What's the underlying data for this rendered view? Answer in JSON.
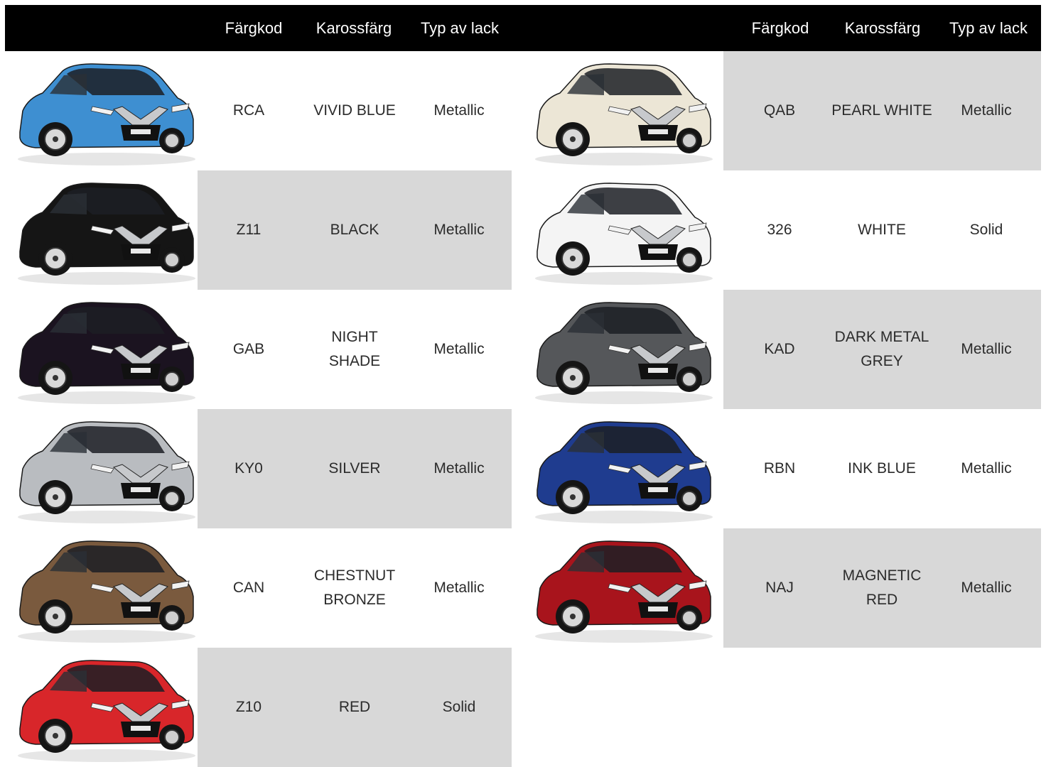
{
  "header": {
    "left": {
      "code": "Färgkod",
      "color": "Karossfärg",
      "paint": "Typ av lack"
    },
    "right": {
      "code": "Färgkod",
      "color": "Karossfärg",
      "paint": "Typ av lack"
    }
  },
  "left_rows": [
    {
      "code": "RCA",
      "color_line1": "VIVID BLUE",
      "color_line2": "",
      "paint": "Metallic",
      "car_hex": "#3e8fd1"
    },
    {
      "code": "Z11",
      "color_line1": "BLACK",
      "color_line2": "",
      "paint": "Metallic",
      "car_hex": "#151515"
    },
    {
      "code": "GAB",
      "color_line1": "NIGHT",
      "color_line2": "SHADE",
      "paint": "Metallic",
      "car_hex": "#1b1320"
    },
    {
      "code": "KY0",
      "color_line1": "SILVER",
      "color_line2": "",
      "paint": "Metallic",
      "car_hex": "#b9bcc0"
    },
    {
      "code": "CAN",
      "color_line1": "CHESTNUT",
      "color_line2": "BRONZE",
      "paint": "Metallic",
      "car_hex": "#7a5a3e"
    },
    {
      "code": "Z10",
      "color_line1": "RED",
      "color_line2": "",
      "paint": "Solid",
      "car_hex": "#d8262a"
    }
  ],
  "right_rows": [
    {
      "code": "QAB",
      "color_line1": "PEARL WHITE",
      "color_line2": "",
      "paint": "Metallic",
      "car_hex": "#ece6d6"
    },
    {
      "code": "326",
      "color_line1": "WHITE",
      "color_line2": "",
      "paint": "Solid",
      "car_hex": "#f4f4f4"
    },
    {
      "code": "KAD",
      "color_line1": "DARK METAL",
      "color_line2": "GREY",
      "paint": "Metallic",
      "car_hex": "#55575a"
    },
    {
      "code": "RBN",
      "color_line1": "INK BLUE",
      "color_line2": "",
      "paint": "Metallic",
      "car_hex": "#1f3c8f"
    },
    {
      "code": "NAJ",
      "color_line1": "MAGNETIC",
      "color_line2": "RED",
      "paint": "Metallic",
      "car_hex": "#a8141c"
    }
  ],
  "colors": {
    "header_bg": "#000000",
    "band_bg": "#d8d8d8",
    "text": "#2b2b2b"
  }
}
